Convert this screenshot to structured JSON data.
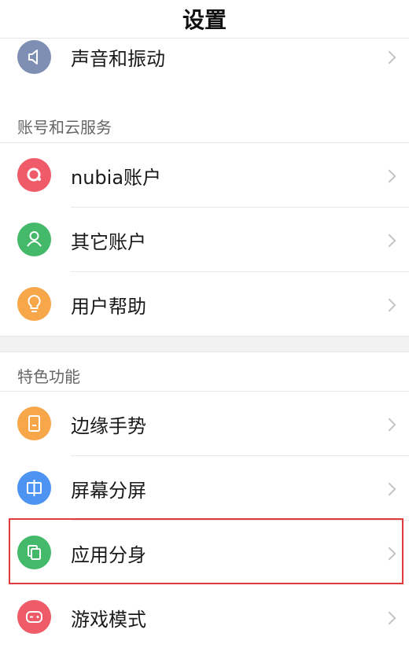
{
  "header": {
    "title": "设置"
  },
  "items": {
    "sound": {
      "label": "声音和振动",
      "icon": "speaker-icon",
      "color": "#7f8fb3"
    },
    "nubia_account": {
      "label": "nubia账户",
      "icon": "nubia-icon",
      "color": "#ef5b68"
    },
    "other_accounts": {
      "label": "其它账户",
      "icon": "person-icon",
      "color": "#45b96a"
    },
    "help": {
      "label": "用户帮助",
      "icon": "bulb-icon",
      "color": "#f7a64a"
    },
    "edge_gesture": {
      "label": "边缘手势",
      "icon": "edge-icon",
      "color": "#f7a64a"
    },
    "split_screen": {
      "label": "屏幕分屏",
      "icon": "split-icon",
      "color": "#4d93f2"
    },
    "app_clone": {
      "label": "应用分身",
      "icon": "clone-icon",
      "color": "#45b96a"
    },
    "game_mode": {
      "label": "游戏模式",
      "icon": "gamepad-icon",
      "color": "#ef5b68"
    }
  },
  "sections": {
    "account": {
      "title": "账号和云服务"
    },
    "features": {
      "title": "特色功能"
    }
  },
  "highlight_color": "#e23a3a"
}
